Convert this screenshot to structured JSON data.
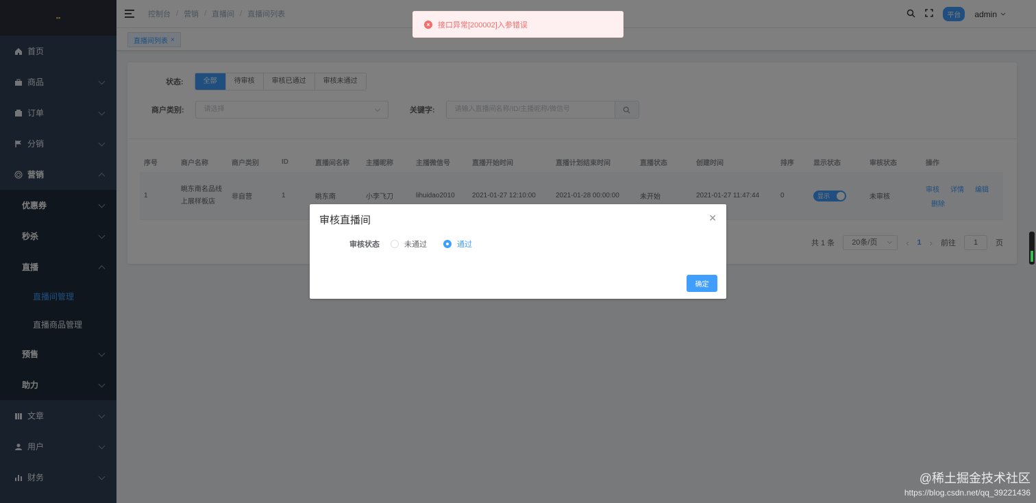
{
  "sidebar": {
    "logo": "▪▪",
    "items": [
      {
        "label": "首页",
        "icon": "home-icon"
      },
      {
        "label": "商品",
        "icon": "bag-icon"
      },
      {
        "label": "订单",
        "icon": "order-icon"
      },
      {
        "label": "分销",
        "icon": "flag-icon"
      },
      {
        "label": "营销",
        "icon": "target-icon"
      }
    ],
    "marketing_sub": [
      "优惠券",
      "秒杀",
      "直播"
    ],
    "live_sub": [
      "直播间管理",
      "直播商品管理"
    ],
    "marketing_sub2": [
      "预售",
      "助力"
    ],
    "bottom_items": [
      {
        "label": "文章",
        "icon": "book-icon"
      },
      {
        "label": "用户",
        "icon": "user-icon"
      },
      {
        "label": "财务",
        "icon": "chart-icon"
      }
    ]
  },
  "header": {
    "breadcrumb": [
      "控制台",
      "营销",
      "直播间",
      "直播间列表"
    ],
    "role": "平台",
    "user": "admin"
  },
  "tags": {
    "active": "直播间列表"
  },
  "filters": {
    "status_label": "状态:",
    "status_options": [
      "全部",
      "待审核",
      "审核已通过",
      "审核未通过"
    ],
    "merchant_label": "商户类别:",
    "merchant_placeholder": "请选择",
    "keyword_label": "关键字:",
    "keyword_placeholder": "请输入直播间名称/ID/主播昵称/微信号"
  },
  "table": {
    "headers": [
      "序号",
      "商户名称",
      "商户类别",
      "ID",
      "直播间名称",
      "主播昵称",
      "主播微信号",
      "直播开始时间",
      "直播计划结束时间",
      "直播状态",
      "创建时间",
      "排序",
      "显示状态",
      "审核状态",
      "操作"
    ],
    "row": {
      "index": "1",
      "merchant": "眺东南名品线上展样板店",
      "merchant_type": "非自营",
      "id": "1",
      "room_name": "眺东南",
      "anchor": "小李飞刀",
      "wechat": "lihuidao2010",
      "start": "2021-01-27 12:10:00",
      "end": "2021-01-28 00:00:00",
      "live_status": "未开始",
      "created": "2021-01-27 11:47:44",
      "sort": "0",
      "display": "显示",
      "audit": "未审核",
      "ops": [
        "审核",
        "详情",
        "编辑",
        "删除"
      ]
    }
  },
  "pager": {
    "total": "共 1 条",
    "size": "20条/页",
    "page": "1",
    "goto": "前往",
    "goto_value": "1",
    "unit": "页"
  },
  "message": {
    "text": "接口异常[200002]入参错误"
  },
  "dialog": {
    "title": "审核直播间",
    "field_label": "审核状态",
    "options": [
      "未通过",
      "通过"
    ],
    "selected": "通过",
    "confirm": "确定"
  },
  "watermark": {
    "line1": "@稀土掘金技术社区",
    "line2": "https://blog.csdn.net/qq_39221436"
  },
  "colors": {
    "primary": "#409eff",
    "sidebar": "#304156",
    "error": "#f56c6c"
  }
}
